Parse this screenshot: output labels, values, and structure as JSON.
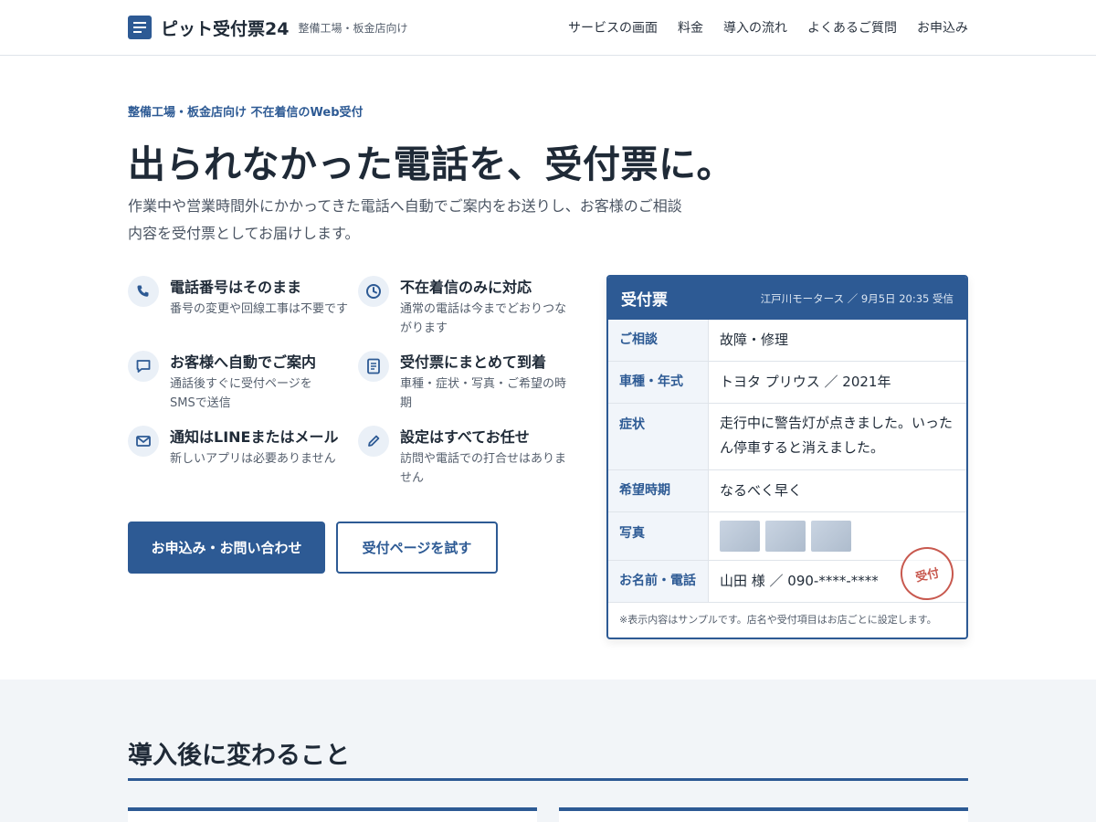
{
  "header": {
    "brand_name": "ピット受付票24",
    "brand_tag": "整備工場・板金店向け",
    "nav": [
      "サービスの画面",
      "料金",
      "導入の流れ",
      "よくあるご質問",
      "お申込み"
    ]
  },
  "hero": {
    "eyebrow": "整備工場・板金店向け 不在着信のWeb受付",
    "headline": "出られなかった電話を、受付票に。",
    "lead": "作業中や営業時間外にかかってきた電話へ自動でご案内をお送りし、お客様のご相談内容を受付票としてお届けします。",
    "features": [
      {
        "icon": "phone-icon",
        "title": "電話番号はそのまま",
        "desc": "番号の変更や回線工事は不要です"
      },
      {
        "icon": "clock-icon",
        "title": "不在着信のみに対応",
        "desc": "通常の電話は今までどおりつながります"
      },
      {
        "icon": "chat-icon",
        "title": "お客様へ自動でご案内",
        "desc": "通話後すぐに受付ページをSMSで送信"
      },
      {
        "icon": "document-icon",
        "title": "受付票にまとめて到着",
        "desc": "車種・症状・写真・ご希望の時期"
      },
      {
        "icon": "mail-icon",
        "title": "通知はLINEまたはメール",
        "desc": "新しいアプリは必要ありません"
      },
      {
        "icon": "pencil-icon",
        "title": "設定はすべてお任せ",
        "desc": "訪問や電話での打合せはありません"
      }
    ],
    "cta_primary": "お申込み・お問い合わせ",
    "cta_secondary": "受付ページを試す"
  },
  "ticket": {
    "title": "受付票",
    "meta": "江戸川モータース ／ 9月5日 20:35 受信",
    "rows": [
      {
        "label": "ご相談",
        "value": "故障・修理"
      },
      {
        "label": "車種・年式",
        "value": "トヨタ プリウス ／ 2021年"
      },
      {
        "label": "症状",
        "value": "走行中に警告灯が点きました。いったん停車すると消えました。"
      },
      {
        "label": "希望時期",
        "value": "なるべく早く"
      },
      {
        "label": "写真",
        "value": ""
      },
      {
        "label": "お名前・電話",
        "value": "山田 様 ／ 090-****-****"
      }
    ],
    "stamp": "受付",
    "note": "※表示内容はサンプルです。店名や受付項目はお店ごとに設定します。"
  },
  "section": {
    "title": "導入後に変わること"
  },
  "colors": {
    "accent": "#2d5a94",
    "stamp": "#c8594f",
    "section_bg": "#f2f5f8"
  }
}
